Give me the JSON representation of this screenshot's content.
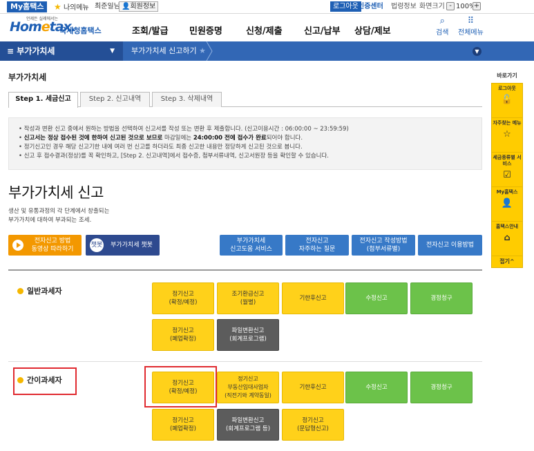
{
  "topbar": {
    "myhome": "My홈택스",
    "mymenu": "나의메뉴",
    "user_name": "최준일님",
    "user_info": "회원정보",
    "logout": "로그아웃",
    "cert_center": "인증센터",
    "law_info": "법령정보",
    "screen_size": "화면크기",
    "zoom_minus": "-",
    "zoom": "100%",
    "zoom_plus": "+"
  },
  "header": {
    "logo_small": "언제든 실례에서는",
    "logo_brand_pre": "Hom",
    "logo_brand_e": "e",
    "logo_brand_post": "tax.",
    "logo_agency": "국세청홈택스",
    "nav": [
      "조회/발급",
      "민원증명",
      "신청/제출",
      "신고/납부",
      "상담/제보"
    ],
    "search": "검색",
    "allmenu": "전체메뉴"
  },
  "navbar": {
    "section": "≡  부가가치세",
    "current": "부가가치세 신고하기"
  },
  "page_title": "부가가치세",
  "tabs": [
    "Step 1. 세금신고",
    "Step 2. 신고내역",
    "Step 3. 삭제내역"
  ],
  "info": {
    "line1": "작성과 변환 신고 중에서 원하는 방법을 선택하여 신고서를 작성 또는 변환 후 제출합니다. (신고이용시간 : 06:00:00 ~ 23:59:59)",
    "line2_b1": "신고서는 정상 접수된 것에 한하여 신고된 것으로 보므로",
    "line2_n1": " 마감일에는 ",
    "line2_b2": "24:00:00 전에 접수가 완료",
    "line2_n2": "되어야 합니다.",
    "line3": "정기신고인 경우 해당 신고기한 내에 여러 번 신고를 하더라도 최종 신고한 내용만 정당하게 신고된 것으로 봅니다.",
    "line4": "신고 후 접수결과(정상)를 꼭 확인하고, [Step 2. 신고내역]에서 접수증, 첨부서류내역, 신고서원장 등을 확인할 수 있습니다."
  },
  "main_heading": "부가가치세 신고",
  "description": {
    "line1": "생산 및 유통과정의 각 단계에서 창출되는",
    "line2": "부가가치에 대하여 부과되는 조세."
  },
  "actions": {
    "video_l1": "전자신고 방법",
    "video_l2": "동영상 따라하기",
    "chatbot_icon": "챗봇",
    "chatbot": "부가가치세 챗봇",
    "help_l1": "부가가치세",
    "help_l2": "신고도움 서비스",
    "faq_l1": "전자신고",
    "faq_l2": "자주하는 질문",
    "howto_l1": "전자신고 작성방법",
    "howto_l2": "(첨부서류별)",
    "usage": "전자신고 이용방법"
  },
  "general": {
    "label": "일반과세자",
    "regular_l1": "정기신고",
    "regular_l2": "(확정/예정)",
    "early_l1": "조기환급신고",
    "early_l2": "(월별)",
    "late": "기한후신고",
    "amend": "수정신고",
    "claim": "경정청구",
    "closing_l1": "정기신고",
    "closing_l2": "(폐업확정)",
    "file_l1": "파일변환신고",
    "file_l2": "(회계프로그램)"
  },
  "simple": {
    "label": "간이과세자",
    "regular_l1": "정기신고",
    "regular_l2": "(확정/예정)",
    "realestate_l1": "정기신고",
    "realestate_l2": "부동산임대사업자",
    "realestate_l3": "(직전기와 계약동일)",
    "late": "기한후신고",
    "amend": "수정신고",
    "claim": "경정청구",
    "closing_l1": "정기신고",
    "closing_l2": "(폐업확정)",
    "file_l1": "파일변환신고",
    "file_l2": "(회계프로그램 등)",
    "qa_l1": "정기신고",
    "qa_l2": "(문답형신고)"
  },
  "quick": {
    "title": "바로가기",
    "logout": "로그아웃",
    "faq_menu": "자주찾는 메뉴",
    "tax_service": "세금종류별 서비스",
    "my_hometax": "My홈택스",
    "guide": "홈택스안내",
    "close": "접기^"
  }
}
